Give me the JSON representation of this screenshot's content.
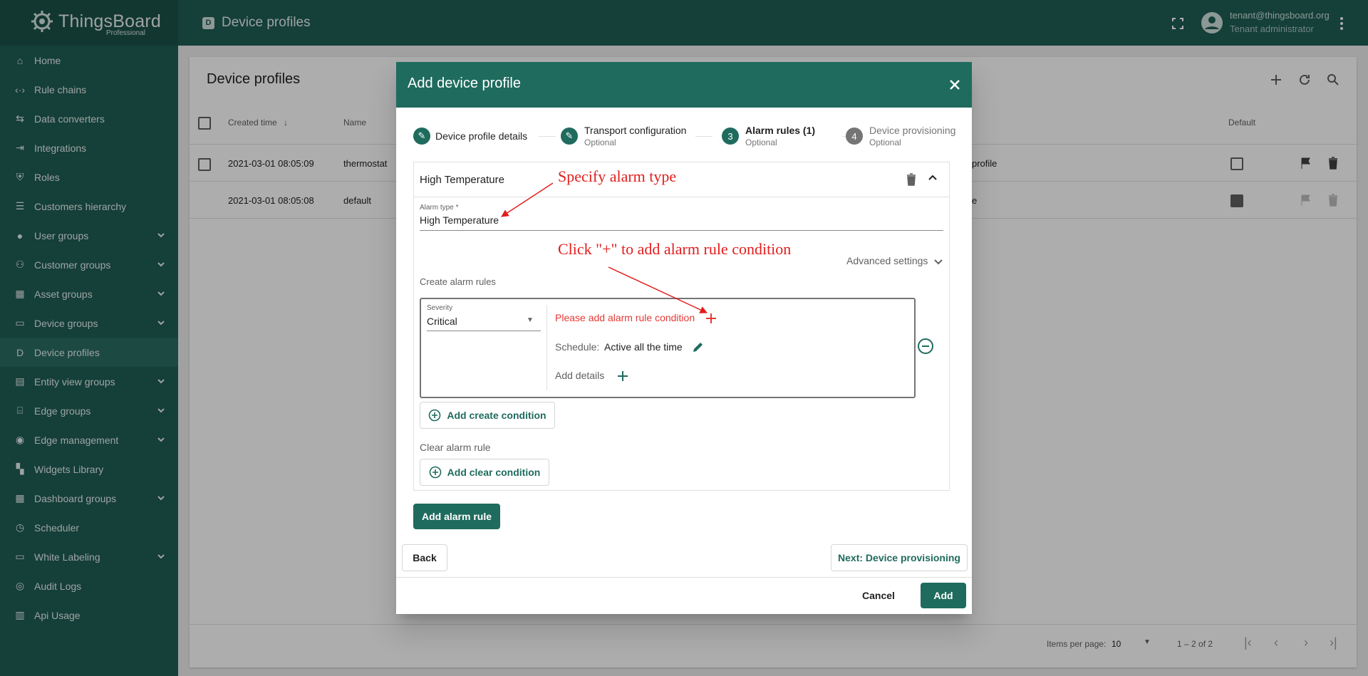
{
  "app": {
    "name": "ThingsBoard",
    "edition": "Professional",
    "page_title": "Device profiles"
  },
  "user": {
    "email": "tenant@thingsboard.org",
    "role": "Tenant administrator"
  },
  "sidebar": {
    "items": [
      {
        "label": "Home",
        "icon": "home-icon",
        "expandable": false
      },
      {
        "label": "Rule chains",
        "icon": "rule-chains-icon",
        "expandable": false
      },
      {
        "label": "Data converters",
        "icon": "data-converters-icon",
        "expandable": false
      },
      {
        "label": "Integrations",
        "icon": "integrations-icon",
        "expandable": false
      },
      {
        "label": "Roles",
        "icon": "shield-icon",
        "expandable": false
      },
      {
        "label": "Customers hierarchy",
        "icon": "hierarchy-icon",
        "expandable": false
      },
      {
        "label": "User groups",
        "icon": "account-icon",
        "expandable": true
      },
      {
        "label": "Customer groups",
        "icon": "people-icon",
        "expandable": true
      },
      {
        "label": "Asset groups",
        "icon": "building-icon",
        "expandable": true
      },
      {
        "label": "Device groups",
        "icon": "devices-icon",
        "expandable": true
      },
      {
        "label": "Device profiles",
        "icon": "device-profile-icon",
        "expandable": false,
        "active": true
      },
      {
        "label": "Entity view groups",
        "icon": "view-icon",
        "expandable": true
      },
      {
        "label": "Edge groups",
        "icon": "router-icon",
        "expandable": true
      },
      {
        "label": "Edge management",
        "icon": "antenna-icon",
        "expandable": true
      },
      {
        "label": "Widgets Library",
        "icon": "widgets-icon",
        "expandable": false
      },
      {
        "label": "Dashboard groups",
        "icon": "dashboard-icon",
        "expandable": true
      },
      {
        "label": "Scheduler",
        "icon": "clock-icon",
        "expandable": false
      },
      {
        "label": "White Labeling",
        "icon": "paint-roller-icon",
        "expandable": true
      },
      {
        "label": "Audit Logs",
        "icon": "audit-icon",
        "expandable": false
      },
      {
        "label": "Api Usage",
        "icon": "chart-icon",
        "expandable": false
      }
    ]
  },
  "table": {
    "title": "Device profiles",
    "columns": [
      "Created time",
      "Name",
      "Default"
    ],
    "rows": [
      {
        "created": "2021-03-01 08:05:09",
        "name": "thermostat",
        "desc": "profile",
        "default": false
      },
      {
        "created": "2021-03-01 08:05:08",
        "name": "default",
        "desc": "e",
        "default": true
      }
    ],
    "items_per_page_label": "Items per page:",
    "items_per_page": "10",
    "range": "1 – 2 of 2"
  },
  "dialog": {
    "title": "Add device profile",
    "steps": [
      {
        "num": "",
        "label": "Device profile details",
        "optional": "",
        "state": "edit"
      },
      {
        "num": "",
        "label": "Transport configuration",
        "optional": "Optional",
        "state": "edit"
      },
      {
        "num": "3",
        "label": "Alarm rules (1)",
        "optional": "Optional",
        "state": "active"
      },
      {
        "num": "4",
        "label": "Device provisioning",
        "optional": "Optional",
        "state": "pending"
      }
    ],
    "alarm": {
      "header_name": "High Temperature",
      "type_label": "Alarm type *",
      "type_value": "High Temperature",
      "advanced": "Advanced settings",
      "create_rules_label": "Create alarm rules",
      "severity_label": "Severity",
      "severity_value": "Critical",
      "condition_error": "Please add alarm rule condition",
      "schedule_label": "Schedule:",
      "schedule_value": "Active all the time",
      "add_details": "Add details",
      "add_create_condition": "Add create condition",
      "clear_rule_label": "Clear alarm rule",
      "add_clear_condition": "Add clear condition"
    },
    "add_alarm_rule": "Add alarm rule",
    "back": "Back",
    "next": "Next: Device provisioning",
    "cancel": "Cancel",
    "add": "Add"
  },
  "annotations": {
    "specify": "Specify alarm type",
    "click_plus": "Click \"+\" to add alarm rule condition",
    "color": "#e31d1d"
  },
  "colors": {
    "primary": "#1f6b5e",
    "sidebar": "#1f5d54",
    "error": "#e53935"
  }
}
